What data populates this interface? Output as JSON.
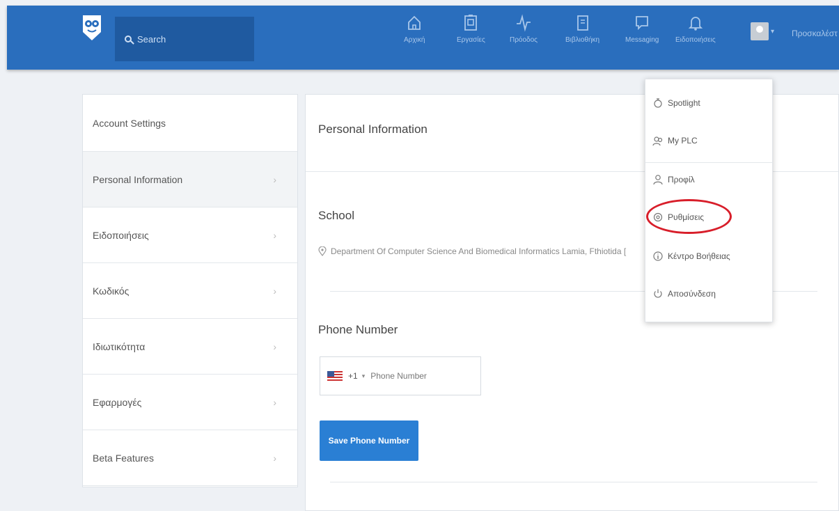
{
  "topbar": {
    "search_placeholder": "Search",
    "nav": [
      {
        "label": "Αρχική",
        "icon": "home-icon"
      },
      {
        "label": "Εργασίες",
        "icon": "assignments-icon"
      },
      {
        "label": "Πρόοδος",
        "icon": "progress-icon"
      },
      {
        "label": "Βιβλιοθήκη",
        "icon": "library-icon"
      },
      {
        "label": "Messaging",
        "icon": "messaging-icon"
      },
      {
        "label": "Ειδοποιήσεις",
        "icon": "bell-icon"
      }
    ],
    "invite_label": "Προσκαλέστ",
    "accent_color": "#2a6ebd"
  },
  "sidebar": {
    "header": "Account Settings",
    "items": [
      {
        "label": "Personal Information"
      },
      {
        "label": "Ειδοποιήσεις"
      },
      {
        "label": "Κωδικός"
      },
      {
        "label": "Ιδιωτικότητα"
      },
      {
        "label": "Εφαρμογές"
      },
      {
        "label": "Beta Features"
      }
    ]
  },
  "main": {
    "title": "Personal Information",
    "school_label": "School",
    "school_value": "Department Of Computer Science And Biomedical Informatics Lamia, Fthiotida [",
    "phone_label": "Phone Number",
    "phone_code": "+1",
    "phone_placeholder": "Phone Number",
    "save_button": "Save Phone Number"
  },
  "dropdown": {
    "items": [
      {
        "label": "Spotlight",
        "icon": "spotlight-icon"
      },
      {
        "label": "My PLC",
        "icon": "plc-icon"
      },
      {
        "label": "Προφίλ",
        "icon": "profile-icon"
      },
      {
        "label": "Ρυθμίσεις",
        "icon": "settings-icon"
      },
      {
        "label": "Κέντρο Βοήθειας",
        "icon": "help-icon"
      },
      {
        "label": "Αποσύνδεση",
        "icon": "power-icon"
      }
    ],
    "highlighted_item": "Ρυθμίσεις",
    "highlight_color": "#d81e2a"
  }
}
